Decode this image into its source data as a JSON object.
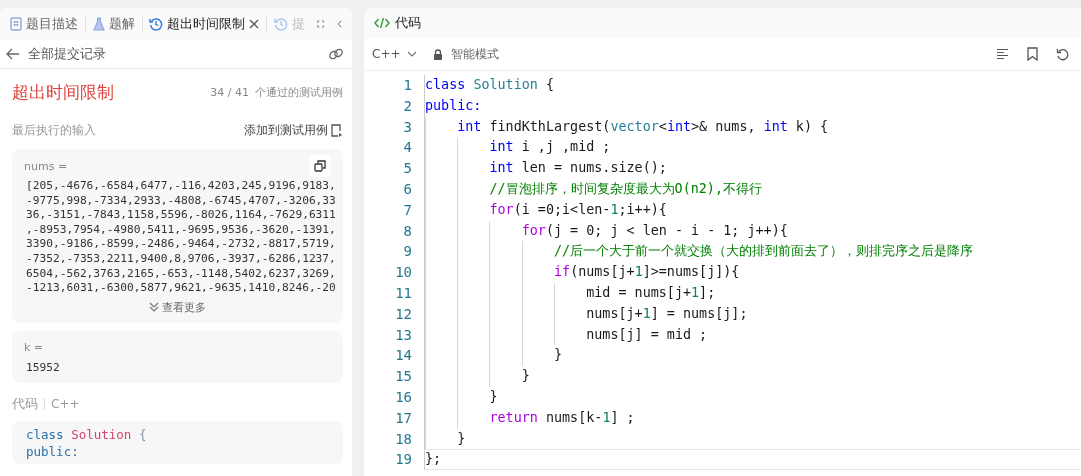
{
  "left_panel": {
    "tabs": [
      {
        "label": "题目描述",
        "kind": "document",
        "selected": false,
        "closable": false
      },
      {
        "label": "题解",
        "kind": "flask",
        "selected": false,
        "closable": false
      },
      {
        "label": "超出时间限制",
        "kind": "history",
        "selected": true,
        "closable": true
      },
      {
        "label": "提",
        "kind": "history",
        "selected": false,
        "closable": false
      }
    ],
    "back_link": "全部提交记录",
    "result": {
      "status": "超出时间限制",
      "passed": "34 / 41",
      "passed_label": "个通过的测试用例"
    },
    "last_input_label": "最后执行的输入",
    "add_testcase": "添加到测试用例",
    "inputs": [
      {
        "name": "nums =",
        "copyable": true,
        "value_lines": [
          "[205,-4676,-6584,6477,-116,4203,245,9196,9183,",
          "-9775,998,-7334,2933,-4808,-6745,4707,-3206,33",
          "36,-3151,-7843,1158,5596,-8026,1164,-7629,6311",
          ",-8953,7954,-4980,5411,-9695,9536,-3620,-1391,",
          "3390,-9186,-8599,-2486,-9464,-2732,-8817,5719,",
          "-7352,-7353,2211,9400,8,9706,-3937,-6286,1237,",
          "6504,-562,3763,2165,-653,-1148,5402,6237,3269,",
          "-1213,6031,-6300,5877,9621,-9635,1410,8246,-20"
        ],
        "more": "查看更多"
      },
      {
        "name": "k =",
        "copyable": false,
        "value_lines": [
          "15952"
        ]
      }
    ],
    "code_label": "代码",
    "code_language": "C++",
    "code_preview": [
      [
        {
          "text": "class ",
          "kind": "kw"
        },
        {
          "text": "Solution",
          "kind": "type"
        },
        {
          "text": " {",
          "kind": "p"
        }
      ],
      [
        {
          "text": "public:",
          "kind": "kw"
        }
      ]
    ]
  },
  "right_panel": {
    "title": "代码",
    "language": "C++",
    "mode": "智能模式",
    "lines": [
      {
        "number": "1",
        "current": false,
        "tokens": [
          {
            "text": "class ",
            "kind": "kw"
          },
          {
            "text": "Solution",
            "kind": "type"
          },
          {
            "text": " {",
            "kind": "p"
          }
        ]
      },
      {
        "number": "2",
        "current": false,
        "tokens": [
          {
            "text": "public:",
            "kind": "kw"
          }
        ]
      },
      {
        "number": "3",
        "current": false,
        "tokens": [
          {
            "text": "    int",
            "kind": "kw"
          },
          {
            "text": " findKthLargest(",
            "kind": "p"
          },
          {
            "text": "vector",
            "kind": "type"
          },
          {
            "text": "<",
            "kind": "p"
          },
          {
            "text": "int",
            "kind": "kw"
          },
          {
            "text": ">& nums, ",
            "kind": "p"
          },
          {
            "text": "int",
            "kind": "kw"
          },
          {
            "text": " k) {",
            "kind": "p"
          }
        ]
      },
      {
        "number": "4",
        "current": false,
        "tokens": [
          {
            "text": "        int",
            "kind": "kw"
          },
          {
            "text": " i ,j ,mid ;",
            "kind": "p"
          }
        ]
      },
      {
        "number": "5",
        "current": false,
        "tokens": [
          {
            "text": "        int",
            "kind": "kw"
          },
          {
            "text": " len = nums.size();",
            "kind": "p"
          }
        ]
      },
      {
        "number": "6",
        "current": false,
        "tokens": [
          {
            "text": "        //冒泡排序，时间复杂度最大为O(n2),不得行",
            "kind": "cmt"
          }
        ]
      },
      {
        "number": "7",
        "current": false,
        "tokens": [
          {
            "text": "        for",
            "kind": "ctrl"
          },
          {
            "text": "(i =0;i<len-",
            "kind": "p"
          },
          {
            "text": "1",
            "kind": "num"
          },
          {
            "text": ";i++){",
            "kind": "p"
          }
        ]
      },
      {
        "number": "8",
        "current": false,
        "tokens": [
          {
            "text": "            for",
            "kind": "ctrl"
          },
          {
            "text": "(j = 0; j < len - i - 1; j++){",
            "kind": "p"
          }
        ]
      },
      {
        "number": "9",
        "current": false,
        "tokens": [
          {
            "text": "                //后一个大于前一个就交换（大的排到前面去了），则排完序之后是降序",
            "kind": "cmt"
          }
        ]
      },
      {
        "number": "10",
        "current": false,
        "tokens": [
          {
            "text": "                if",
            "kind": "ctrl"
          },
          {
            "text": "(nums[j+",
            "kind": "p"
          },
          {
            "text": "1",
            "kind": "num"
          },
          {
            "text": "]>=nums[j]){",
            "kind": "p"
          }
        ]
      },
      {
        "number": "11",
        "current": false,
        "tokens": [
          {
            "text": "                    mid = nums[j+",
            "kind": "p"
          },
          {
            "text": "1",
            "kind": "num"
          },
          {
            "text": "];",
            "kind": "p"
          }
        ]
      },
      {
        "number": "12",
        "current": false,
        "tokens": [
          {
            "text": "                    nums[j+",
            "kind": "p"
          },
          {
            "text": "1",
            "kind": "num"
          },
          {
            "text": "] = nums[j];",
            "kind": "p"
          }
        ]
      },
      {
        "number": "13",
        "current": false,
        "tokens": [
          {
            "text": "                    nums[j] = mid ;",
            "kind": "p"
          }
        ]
      },
      {
        "number": "14",
        "current": false,
        "tokens": [
          {
            "text": "                }",
            "kind": "p"
          }
        ]
      },
      {
        "number": "15",
        "current": false,
        "tokens": [
          {
            "text": "            }",
            "kind": "p"
          }
        ]
      },
      {
        "number": "16",
        "current": false,
        "tokens": [
          {
            "text": "        }",
            "kind": "p"
          }
        ]
      },
      {
        "number": "17",
        "current": false,
        "tokens": [
          {
            "text": "        return",
            "kind": "ctrl"
          },
          {
            "text": " nums[k-",
            "kind": "p"
          },
          {
            "text": "1",
            "kind": "num"
          },
          {
            "text": "] ;",
            "kind": "p"
          }
        ]
      },
      {
        "number": "18",
        "current": false,
        "tokens": [
          {
            "text": "    }",
            "kind": "p"
          }
        ]
      },
      {
        "number": "19",
        "current": true,
        "tokens": [
          {
            "text": "};",
            "kind": "p"
          }
        ]
      }
    ]
  }
}
